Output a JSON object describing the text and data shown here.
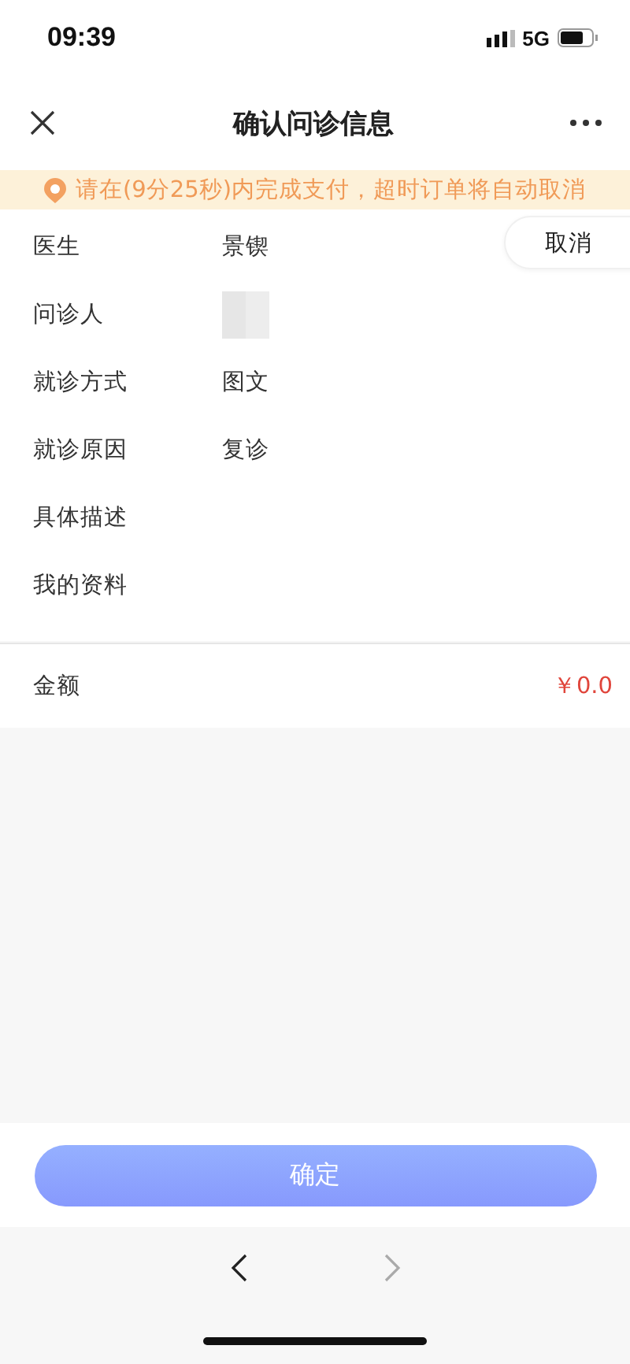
{
  "status_bar": {
    "time": "09:39",
    "network": "5G"
  },
  "nav": {
    "title": "确认问诊信息"
  },
  "notice": {
    "text": "请在(9分25秒)内完成支付，超时订单将自动取消"
  },
  "cancel_button": {
    "label": "取消"
  },
  "fields": [
    {
      "label": "医生",
      "kind": "text",
      "value": "景锲"
    },
    {
      "label": "问诊人",
      "kind": "redacted"
    },
    {
      "label": "就诊方式",
      "kind": "text",
      "value": "图文"
    },
    {
      "label": "就诊原因",
      "kind": "text",
      "value": "复诊"
    },
    {
      "label": "具体描述",
      "kind": "empty"
    },
    {
      "label": "我的资料",
      "kind": "empty"
    }
  ],
  "amount": {
    "label": "金额",
    "value": "￥0.0"
  },
  "confirm_button": {
    "label": "确定"
  },
  "browser_nav": [
    {
      "kind": "back",
      "disabled": false
    },
    {
      "kind": "forward",
      "disabled": true
    }
  ]
}
